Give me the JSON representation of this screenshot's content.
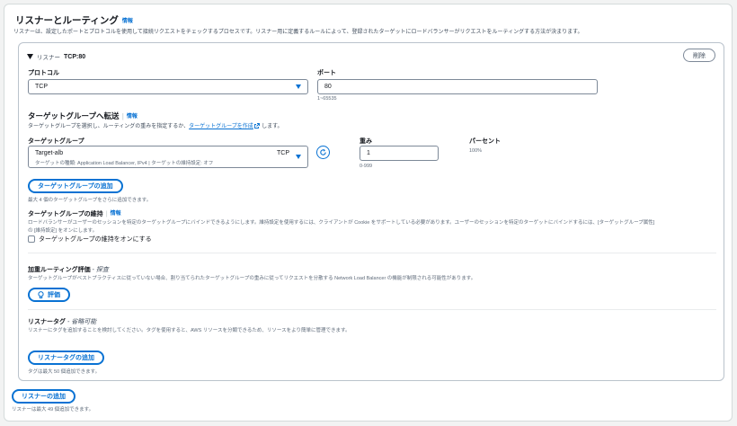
{
  "section": {
    "title": "リスナーとルーティング",
    "info": "情報",
    "description": "リスナーは、設定したポートとプロトコルを使用して接続リクエストをチェックするプロセスです。リスナー用に定義するルールによって、登録されたターゲットにロードバランサーがリクエストをルーティングする方法が決まります。"
  },
  "listener": {
    "toggle_label": "リスナー",
    "name": "TCP:80",
    "remove_label": "削除",
    "protocol": {
      "label": "プロトコル",
      "value": "TCP"
    },
    "port": {
      "label": "ポート",
      "value": "80",
      "hint": "1~65535"
    }
  },
  "forward": {
    "title": "ターゲットグループへ転送",
    "info": "情報",
    "desc_before": "ターゲットグループを選択し、ルーティングの重みを指定するか、",
    "link": "ターゲットグループを作成",
    "desc_after": "します。",
    "target_group": {
      "label": "ターゲットグループ",
      "name": "Target-alb",
      "protocol": "TCP",
      "detail": "ターゲットの種類: Application Load Balancer, IPv4 | ターゲットの維持設定: オフ"
    },
    "weight": {
      "label": "重み",
      "value": "1",
      "hint": "0-999"
    },
    "percent": {
      "label": "パーセント",
      "value": "100%"
    },
    "add_button": "ターゲットグループの追加",
    "add_hint": "最大 4 個のターゲットグループをさらに追加できます。"
  },
  "stickiness": {
    "title": "ターゲットグループの維持",
    "info": "情報",
    "desc_line1": "ロードバランサーがユーザーのセッションを特定のターゲットグループにバインドできるようにします。維持設定を使用するには、クライアントが Cookie をサポートしている必要があります。ユーザーのセッションを特定のターゲットにバインドするには、[ターゲットグループ属性]",
    "desc_line2": "の [維持設定] をオンにします。",
    "checkbox_label": "ターゲットグループの維持をオンにする"
  },
  "weighted": {
    "title": "加重ルーティング評価",
    "optional": "- 探査",
    "desc": "ターゲットグループがベストプラクティスに従っていない場合、割り当てられたターゲットグループの重みに従ってリクエストを分散する Network Load Balancer の機能が制限される可能性があります。",
    "button": "評価"
  },
  "tags": {
    "title": "リスナータグ",
    "optional": "- 省略可能",
    "desc": "リスナーにタグを追加することを検討してください。タグを使用すると、AWS リソースを分類できるため、リソースをより簡単に管理できます。",
    "button": "リスナータグの追加",
    "hint": "タグは最大 50 個追加できます。"
  },
  "footer": {
    "add_listener": "リスナーの追加",
    "hint": "リスナーは最大 49 個追加できます。"
  },
  "colors": {
    "accent": "#0972d3",
    "border": "#7d8998",
    "text": "#16191f"
  },
  "icons": [
    "caret-down-icon",
    "external-link-icon",
    "refresh-icon",
    "lightbulb-icon",
    "checkbox-icon",
    "dropdown-icon"
  ]
}
